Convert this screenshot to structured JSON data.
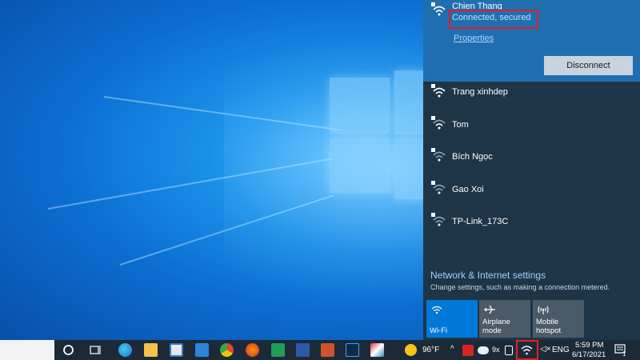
{
  "flyout": {
    "connected_network": {
      "name": "Chien Thang",
      "status": "Connected, secured",
      "properties_label": "Properties",
      "disconnect_label": "Disconnect"
    },
    "networks": [
      {
        "name": "Trang xinhdep",
        "secured": true
      },
      {
        "name": "Tom",
        "secured": true
      },
      {
        "name": "Bích Ngọc",
        "secured": true
      },
      {
        "name": "Gao Xoi",
        "secured": true
      },
      {
        "name": "TP-Link_173C",
        "secured": true
      }
    ],
    "settings": {
      "title": "Network & Internet settings",
      "subtitle": "Change settings, such as making a connection metered."
    },
    "quick_actions": [
      {
        "label": "Wi-Fi",
        "icon": "wifi-icon",
        "active": true
      },
      {
        "label": "Airplane mode",
        "icon": "airplane-icon",
        "active": false
      },
      {
        "label": "Mobile\nhotspot",
        "icon": "hotspot-icon",
        "active": false
      }
    ]
  },
  "taskbar": {
    "weather": "96°F",
    "language": "ENG",
    "time": "5:59 PM",
    "date": "6/17/2021",
    "notification_count": "1",
    "pinned_apps": [
      "task-view",
      "edge",
      "file-explorer",
      "store",
      "mail",
      "chrome",
      "firefox",
      "excel",
      "word",
      "powerpoint",
      "photoshop",
      "paint"
    ]
  },
  "colors": {
    "accent": "#0078d7",
    "flyout_bg": "#1e3548",
    "connected_bg": "#1f6fb0",
    "highlight_box": "#e02020",
    "link": "#9cd2ff"
  }
}
